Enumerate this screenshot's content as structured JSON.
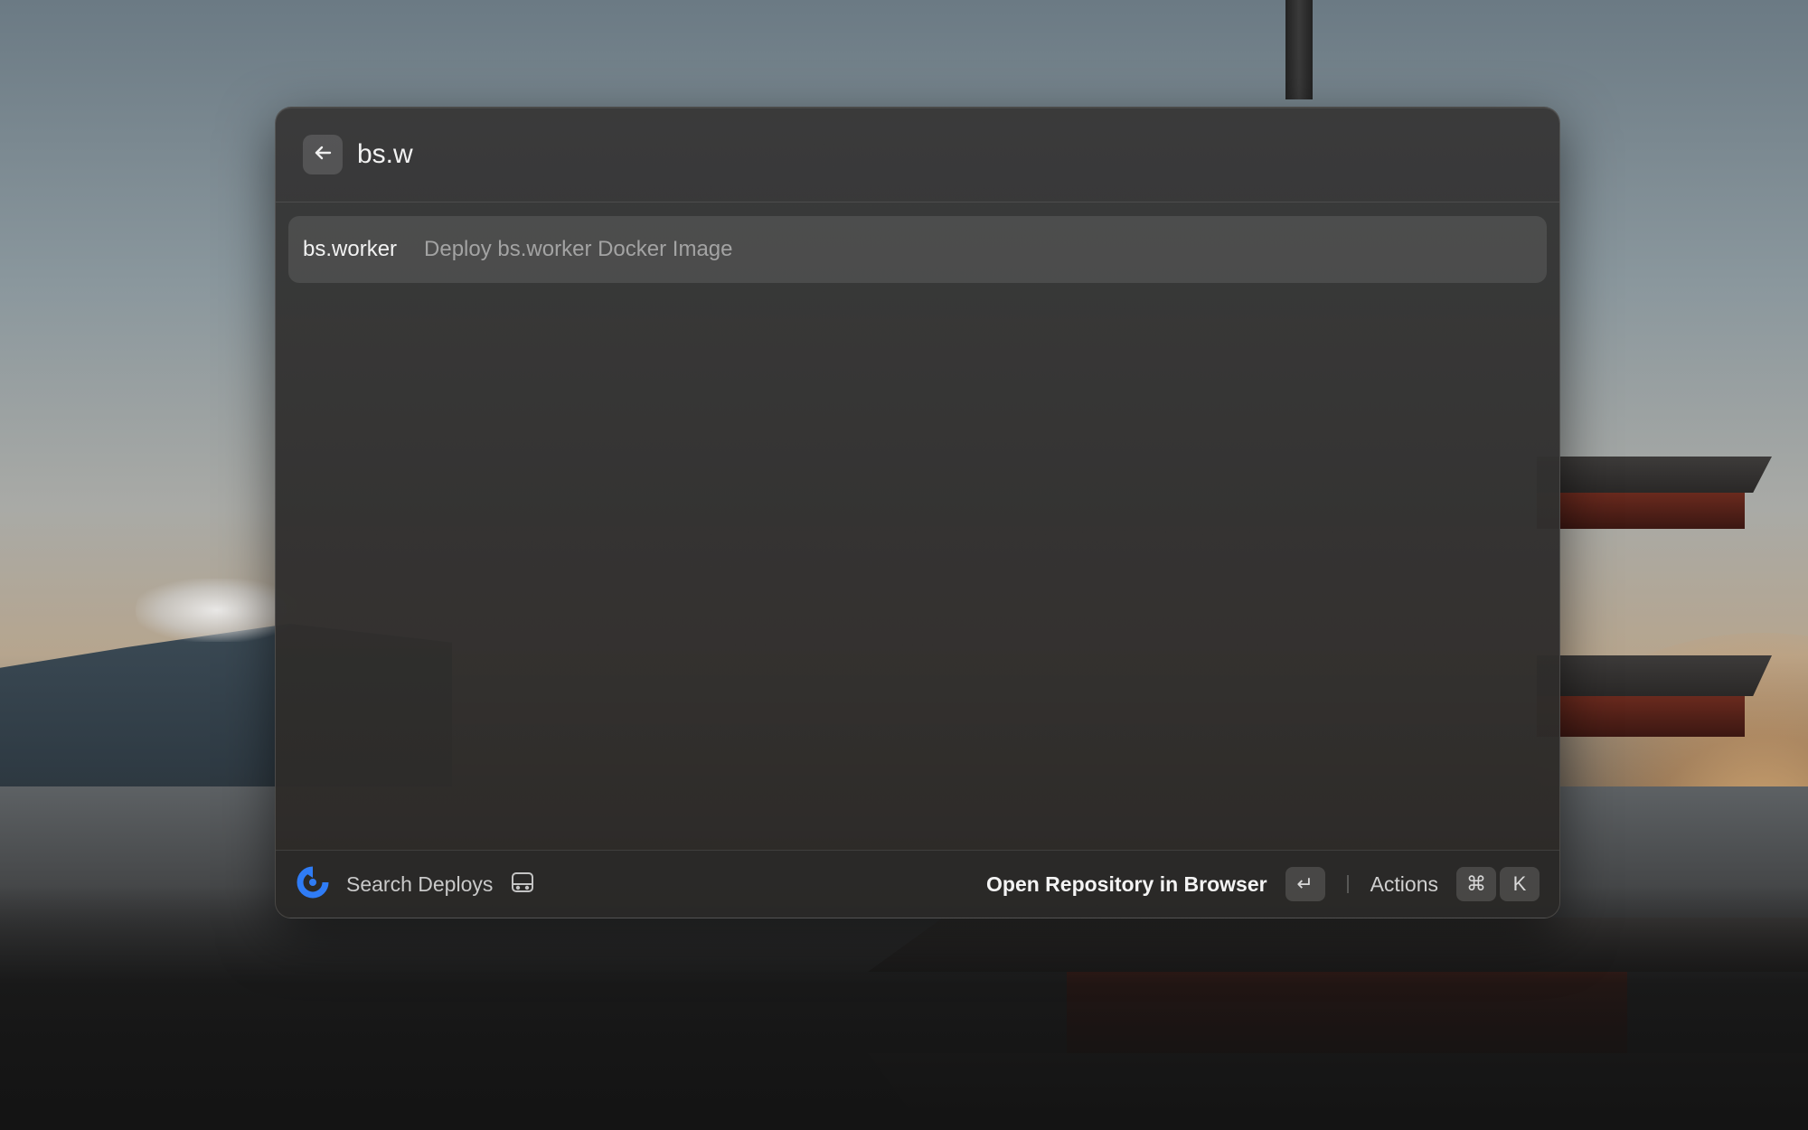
{
  "search": {
    "query": "bs.w"
  },
  "results": [
    {
      "title": "bs.worker",
      "subtitle": "Deploy bs.worker Docker Image"
    }
  ],
  "footer": {
    "app_title": "Search Deploys",
    "primary_action": "Open Repository in Browser",
    "enter_key": "↵",
    "actions_label": "Actions",
    "cmd_key": "⌘",
    "k_key": "K"
  },
  "icons": {
    "back": "arrow-left-icon",
    "app": "deploy-app-icon",
    "drive": "hard-drive-icon"
  },
  "colors": {
    "app_icon_blue": "#2f7cf6"
  }
}
